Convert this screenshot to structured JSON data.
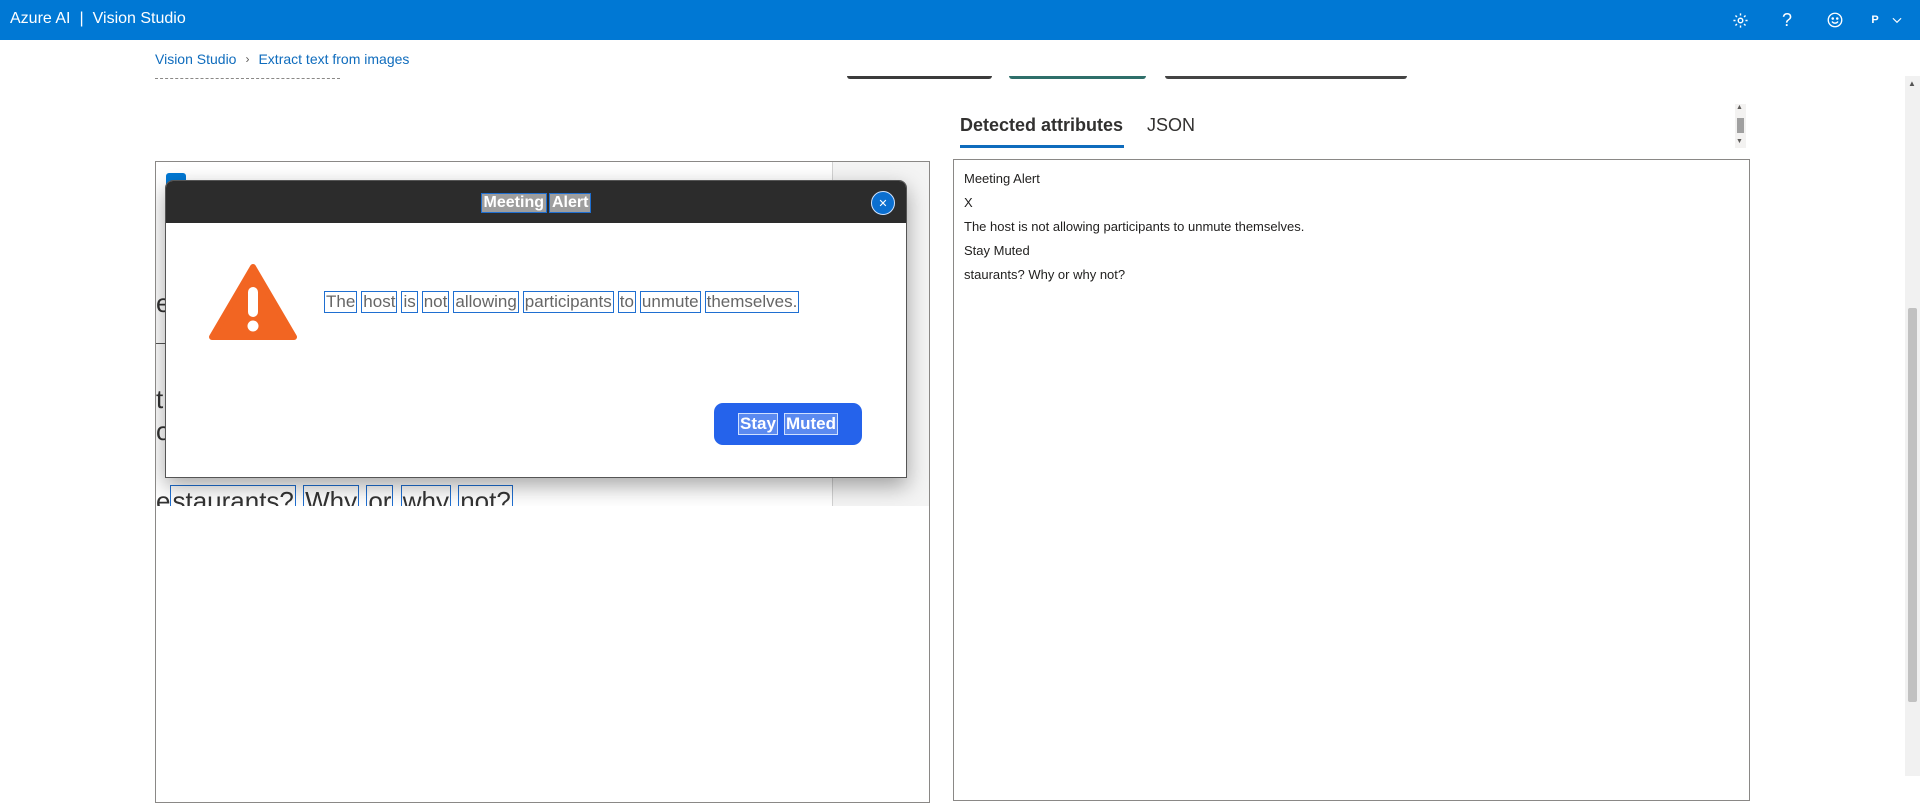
{
  "app": {
    "brand": "Azure AI",
    "separator": "|",
    "product": "Vision Studio",
    "header_icons": [
      "gear-icon",
      "help-icon",
      "smiley-icon"
    ],
    "account_initial": "P"
  },
  "breadcrumb": {
    "root": "Vision Studio",
    "current": "Extract text from images"
  },
  "tabs": {
    "active": "Detected attributes",
    "other": "JSON"
  },
  "preview": {
    "dialog": {
      "title_words": [
        "Meeting",
        "Alert"
      ],
      "close_glyph": "✕",
      "message_words": [
        "The",
        "host",
        "is",
        "not",
        "allowing",
        "participants",
        "to",
        "unmute",
        "themselves."
      ],
      "button_words": [
        "Stay",
        "Muted"
      ]
    },
    "background": {
      "fragments": [
        "e",
        "t",
        "o"
      ],
      "row_prefix": "e",
      "row_words": [
        "staurants?",
        "Why",
        "or",
        "why",
        "not?"
      ],
      "row_gaps": [
        "",
        "",
        "",
        "",
        ""
      ]
    }
  },
  "detected_text": [
    "Meeting Alert",
    "X",
    "The host is not allowing participants to unmute themselves.",
    "Stay Muted",
    "staurants? Why or why not?"
  ],
  "colors": {
    "brand_blue": "#0078d4",
    "link_blue": "#0f6cbd",
    "dialog_header": "#2c2c2c",
    "warning_orange": "#f26522",
    "button_blue": "#2563eb"
  }
}
